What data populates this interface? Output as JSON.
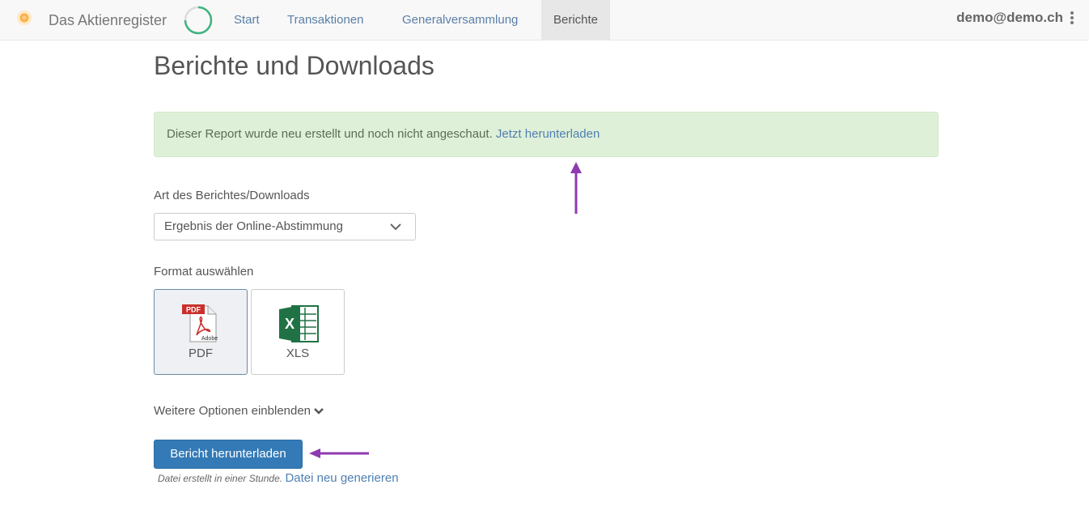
{
  "navbar": {
    "brand": "Das Aktienregister",
    "items": [
      {
        "label": "Start"
      },
      {
        "label": "Transaktionen"
      },
      {
        "label": "Generalversammlung"
      },
      {
        "label": "Berichte"
      }
    ],
    "user": "demo@demo.ch"
  },
  "page": {
    "title": "Berichte und Downloads"
  },
  "alert": {
    "text": "Dieser Report wurde neu erstellt und noch nicht angeschaut.",
    "link": "Jetzt herunterladen"
  },
  "report_type": {
    "label": "Art des Berichtes/Downloads",
    "value": "Ergebnis der Online-Abstimmung"
  },
  "format": {
    "label": "Format auswählen",
    "options": [
      {
        "label": "PDF",
        "icon_text": "PDF",
        "icon_sub": "Adobe",
        "selected": true
      },
      {
        "label": "XLS",
        "icon_text": "X",
        "selected": false
      }
    ]
  },
  "more_options": "Weitere Optionen einblenden",
  "download_button": "Bericht herunterladen",
  "file_note": {
    "text": "Datei erstellt in einer Stunde.",
    "link": "Datei neu generieren"
  },
  "colors": {
    "accent": "#337ab7",
    "alert_bg": "#dff0d8",
    "annotation_arrow": "#8e3ab0"
  }
}
